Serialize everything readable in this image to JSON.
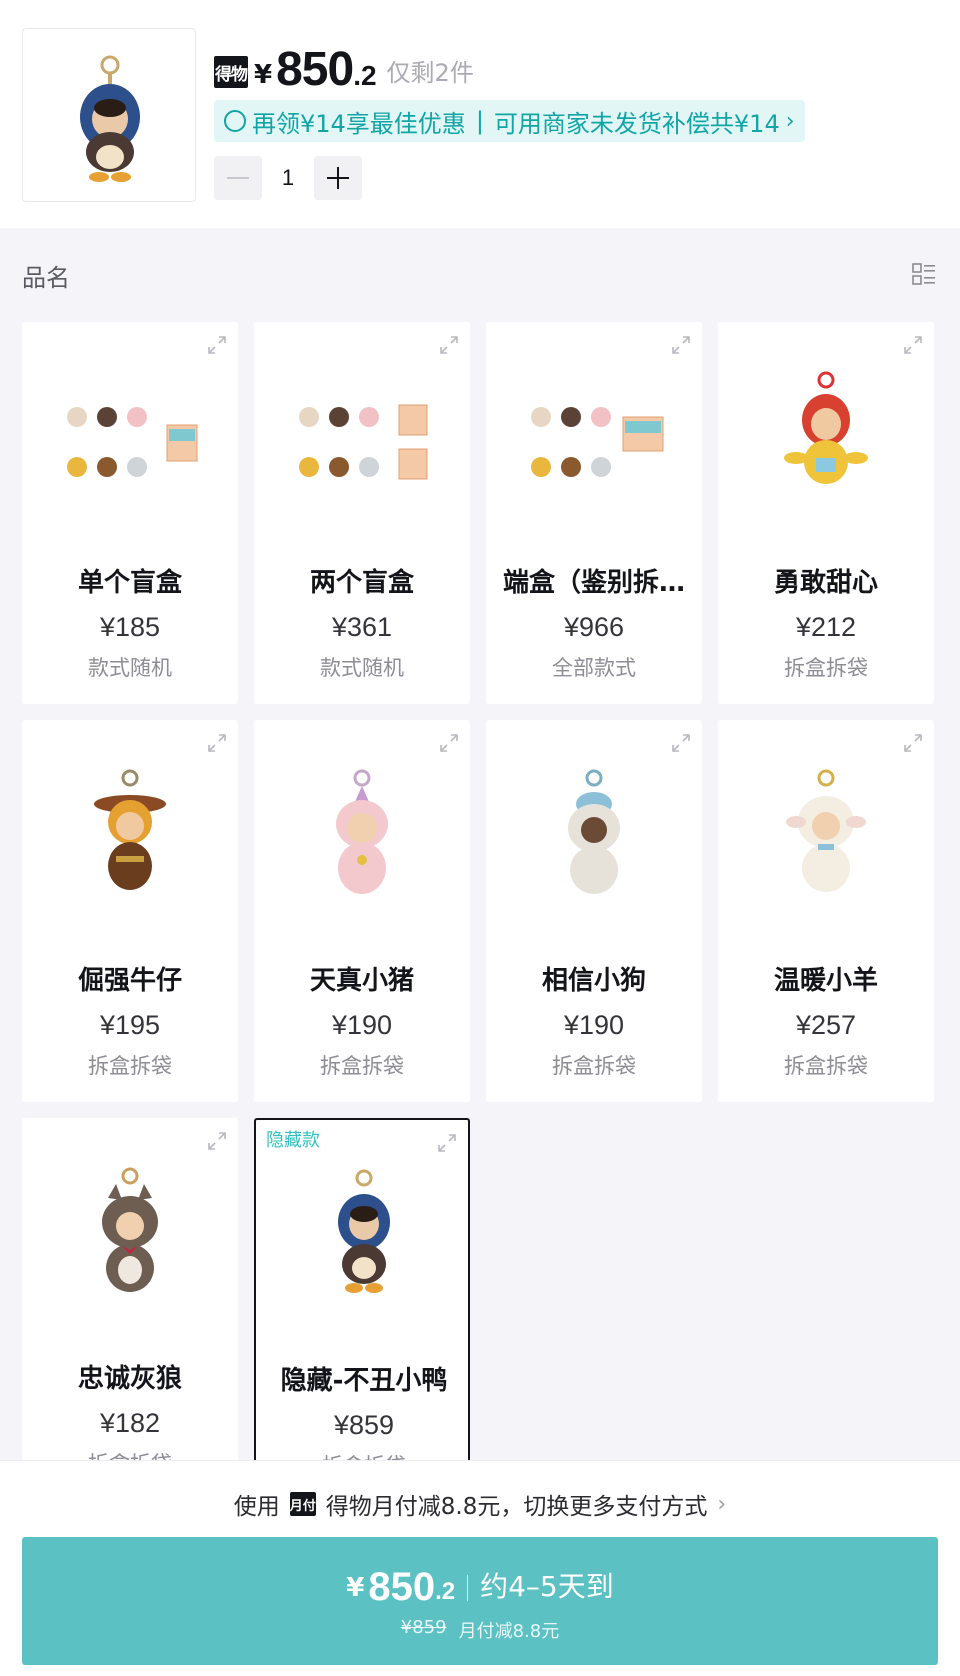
{
  "header": {
    "brand_badge": "得物",
    "currency": "¥",
    "price_int": "850",
    "price_dec": ".2",
    "stock": "仅剩2件",
    "coupon": {
      "left": "再领¥14享最佳优惠",
      "divider": "|",
      "right": "可用商家未发货补偿共¥14"
    },
    "quantity": "1"
  },
  "section": {
    "title": "品名"
  },
  "products": [
    {
      "name": "单个盲盒",
      "price": "¥185",
      "sub": "款式随机",
      "hidden_tag": "",
      "selected": false
    },
    {
      "name": "两个盲盒",
      "price": "¥361",
      "sub": "款式随机",
      "hidden_tag": "",
      "selected": false
    },
    {
      "name": "端盒（鉴别拆…",
      "price": "¥966",
      "sub": "全部款式",
      "hidden_tag": "",
      "selected": false
    },
    {
      "name": "勇敢甜心",
      "price": "¥212",
      "sub": "拆盒拆袋",
      "hidden_tag": "",
      "selected": false
    },
    {
      "name": "倔强牛仔",
      "price": "¥195",
      "sub": "拆盒拆袋",
      "hidden_tag": "",
      "selected": false
    },
    {
      "name": "天真小猪",
      "price": "¥190",
      "sub": "拆盒拆袋",
      "hidden_tag": "",
      "selected": false
    },
    {
      "name": "相信小狗",
      "price": "¥190",
      "sub": "拆盒拆袋",
      "hidden_tag": "",
      "selected": false
    },
    {
      "name": "温暖小羊",
      "price": "¥257",
      "sub": "拆盒拆袋",
      "hidden_tag": "",
      "selected": false
    },
    {
      "name": "忠诚灰狼",
      "price": "¥182",
      "sub": "拆盒拆袋",
      "hidden_tag": "",
      "selected": false
    },
    {
      "name": "隐藏-不丑小鸭",
      "price": "¥859",
      "sub": "拆盒拆袋",
      "hidden_tag": "隐藏款",
      "selected": true
    }
  ],
  "footer": {
    "pay_prefix": "使用",
    "month_badge": "月付",
    "pay_text": "得物月付减8.8元，切换更多支付方式",
    "buy": {
      "currency": "¥",
      "price_int": "850",
      "price_dec": ".2",
      "eta": "约4–5天到",
      "original": "¥859",
      "discount": "月付减8.8元"
    }
  },
  "colors": {
    "accent": "#5bc1c3",
    "coupon_text": "#12a5a5",
    "coupon_bg": "#e3f6f6",
    "hidden_tag": "#32c1c1"
  }
}
